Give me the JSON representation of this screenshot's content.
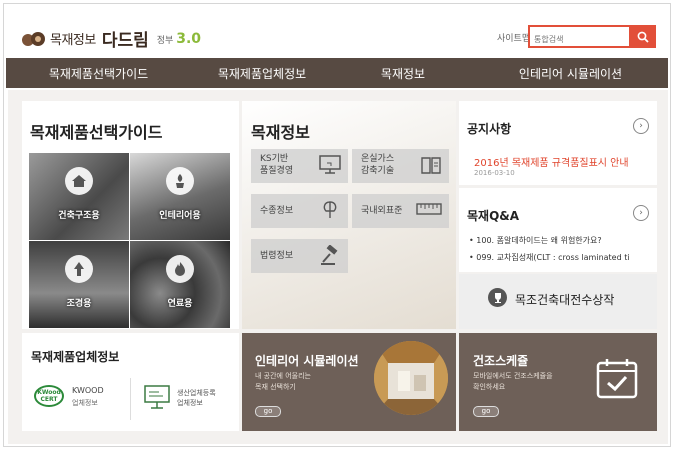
{
  "header": {
    "logo_text": "목재정보",
    "logo_big": "다드림",
    "logo_ver_prefix": "정부",
    "logo_ver_num": "3.0",
    "sitemap": "사이트맵",
    "search_placeholder": "통합검색"
  },
  "nav": [
    "목재제품선택가이드",
    "목재제품업체정보",
    "목재정보",
    "인테리어 시뮬레이션"
  ],
  "guide": {
    "title": "목재제품선택가이드",
    "tiles": [
      "건축구조용",
      "인테리어용",
      "조경용",
      "연료용"
    ]
  },
  "woodinfo": {
    "title": "목재정보",
    "buttons": [
      {
        "label": "KS기반\n품질경영",
        "icon": "monitor-icon"
      },
      {
        "label": "온실가스\n감축기술",
        "icon": "book-icon"
      },
      {
        "label": "수종정보",
        "icon": "tree-info-icon"
      },
      {
        "label": "국내외표준",
        "icon": "ruler-icon"
      },
      {
        "label": "법령정보",
        "icon": "gavel-icon"
      }
    ]
  },
  "notice": {
    "title": "공지사항",
    "more": "›",
    "item": "2016년 목재제품 규격품질표시 안내",
    "date": "2016-03-10"
  },
  "qa": {
    "title": "목재Q&A",
    "more": "›",
    "items": [
      "• 100. 폼알데하이드는 왜 위험한가요?",
      "• 099. 교차집성재(CLT : cross laminated ti"
    ]
  },
  "award": {
    "label": "목조건축대전수상작"
  },
  "company": {
    "title": "목재제품업체정보",
    "badge_top": "KWood",
    "badge_bottom": "CERT",
    "kwood": "KWOOD",
    "kwood_sub": "업체정보",
    "prod_line1": "생산업체등록",
    "prod_line2": "업체정보"
  },
  "interior": {
    "title": "인테리어 시뮬레이션",
    "desc_line1": "내 공간에 어울리는",
    "desc_line2": "목재 선택하기",
    "go": "go"
  },
  "schedule": {
    "title": "건조스케쥴",
    "desc_line1": "모바일에서도 건조스케쥴을",
    "desc_line2": "확인하세요",
    "go": "go"
  },
  "colors": {
    "accent": "#e24f39",
    "nav": "#574a42",
    "tile_brown": "#6e6058"
  }
}
